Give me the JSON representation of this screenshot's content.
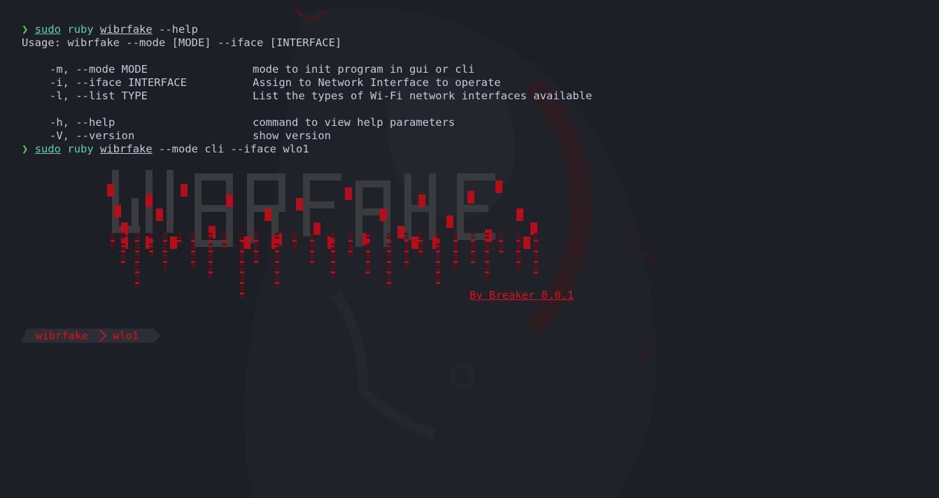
{
  "theme": {
    "background": "#1d1f26",
    "text": "#c3c8da",
    "accent_red": "#e0101c",
    "prompt_green": "#62c45c",
    "command_teal": "#5fd0b3"
  },
  "prompt": {
    "symbol": "❯"
  },
  "cmd1": {
    "sudo": "sudo",
    "ruby": "ruby",
    "file": "wibrfake",
    "args": " --help"
  },
  "usage": "Usage: wibrfake --mode [MODE] --iface [INTERFACE]",
  "options": [
    {
      "flag": "-m, --mode MODE",
      "desc": "mode to init program in gui or cli"
    },
    {
      "flag": "-i, --iface INTERFACE",
      "desc": "Assign to Network Interface to operate"
    },
    {
      "flag": "-l, --list TYPE",
      "desc": "List the types of Wi-Fi network interfaces available"
    },
    {
      "flag": "-h, --help",
      "desc": "command to view help parameters"
    },
    {
      "flag": "-V, --version",
      "desc": "show version"
    }
  ],
  "cmd2": {
    "sudo": "sudo",
    "ruby": "ruby",
    "file": "wibrfake",
    "args": " --mode cli --iface wlo1"
  },
  "banner": {
    "word": "WIBRFAKE",
    "credit": "By Breaker 0.0.1"
  },
  "powerline": {
    "app": "wibrfake",
    "iface": "wlo1"
  }
}
